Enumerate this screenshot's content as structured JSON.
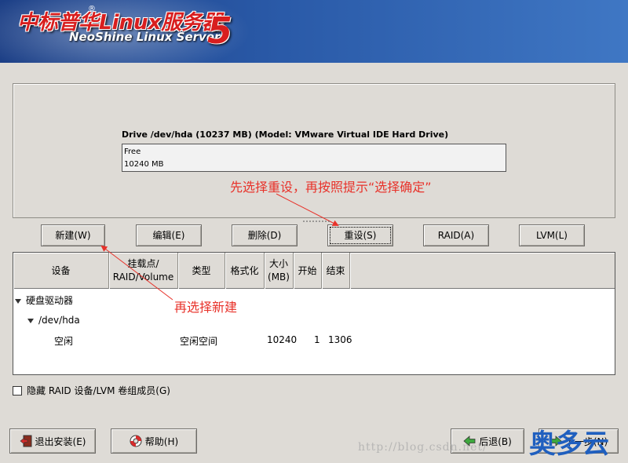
{
  "banner": {
    "title": "中标普华",
    "title_latin": "Linux服务器",
    "registered": "®",
    "subtitle": "NeoShine Linux Server",
    "version": "5"
  },
  "drive": {
    "title": "Drive /dev/hda (10237 MB) (Model: VMware Virtual IDE Hard Drive)",
    "segment_label": "Free",
    "segment_size": "10240 MB"
  },
  "toolbar": {
    "new_label": "新建(W)",
    "edit_label": "编辑(E)",
    "delete_label": "删除(D)",
    "reset_label": "重设(S)",
    "raid_label": "RAID(A)",
    "lvm_label": "LVM(L)"
  },
  "table": {
    "headers": [
      "设备",
      "挂载点/RAID/Volume",
      "类型",
      "格式化",
      "大小(MB)",
      "开始",
      "结束"
    ],
    "header_lines": {
      "mount1": "挂载点/",
      "mount2": "RAID/Volume",
      "size1": "大小",
      "size2": "(MB)"
    },
    "tree": {
      "group": "硬盘驱动器",
      "device": "/dev/hda",
      "rows": [
        {
          "device": "空闲",
          "mount": "",
          "type": "空闲空间",
          "format": "",
          "size": "10240",
          "start": "1",
          "end": "1306"
        }
      ]
    }
  },
  "hide_option": {
    "label": "隐藏 RAID 设备/LVM 卷组成员(G)",
    "checked": false
  },
  "footer": {
    "exit_label": "退出安装(E)",
    "help_label": "帮助(H)",
    "back_label": "后退(B)",
    "next_label": "下一步(N)"
  },
  "annotations": {
    "top": "先选择重设，再按照提示“选择确定”",
    "bottom": "再选择新建"
  },
  "watermark": "http://blog.csdn.net/",
  "brand": "奥多云",
  "colors": {
    "annotation": "#e8322a",
    "banner": "#2a5aa8",
    "brand": "#1f5fbf"
  }
}
